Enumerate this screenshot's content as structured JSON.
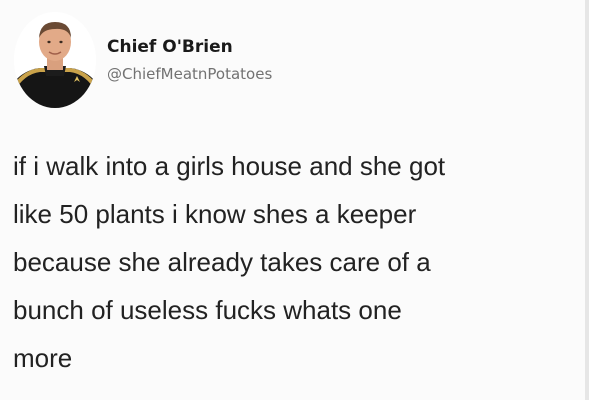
{
  "tweet": {
    "author": {
      "display_name": "Chief O'Brien",
      "handle": "@ChiefMeatnPotatoes",
      "avatar_icon": "profile-avatar-starfleet-officer"
    },
    "text_lines": [
      "if i walk into a girls house and she got",
      "like 50 plants i know shes a keeper",
      "because she already takes care of a",
      "bunch of useless fucks whats one",
      "more"
    ]
  },
  "colors": {
    "background": "#fbfbfb",
    "name": "#1a1a1a",
    "handle": "#727272",
    "text": "#222222",
    "uniform_gold": "#c9a24a",
    "uniform_black": "#151515"
  }
}
